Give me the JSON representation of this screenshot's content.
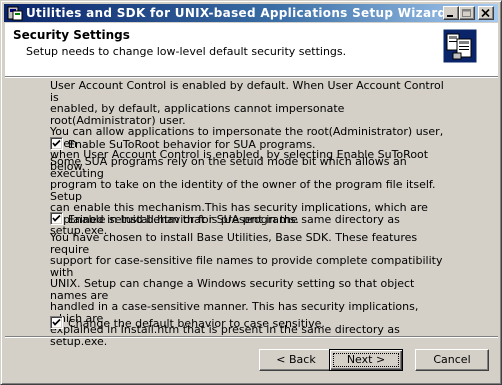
{
  "window": {
    "title": "Utilities and SDK for UNIX-based Applications Setup Wizard"
  },
  "header": {
    "title": "Security Settings",
    "subtitle": "Setup needs to change low-level default security settings."
  },
  "content": {
    "paragraphs": [
      [
        "User Account Control is enabled by default. When User Account Control is",
        "enabled, by default, applications cannot impersonate root(Administrator) user.",
        "You can allow applications to impersonate the root(Administrator) user, even",
        "when User Account Control is enabled, by selecting Enable SuToRoot below."
      ],
      [
        "Some SUA programs rely on the setuid mode bit which allows an executing",
        "program to take on the identity of the owner of the program file itself. Setup",
        "can enable this mechanism.This has security implications, which are",
        "explained in Install.htm that is present in the same directory as setup.exe."
      ],
      [
        "You have chosen to install Base Utilities, Base SDK. These features require",
        "support for case-sensitive file names to provide complete compatibility with",
        "UNIX. Setup can change a Windows security setting so that object names are",
        "handled in a case-sensitive manner. This has security implications, which are",
        "explained in Install.htm that is present in the same directory as setup.exe."
      ]
    ],
    "checkboxes": [
      {
        "label": "Enable SuToRoot behavior for SUA programs.",
        "checked": true
      },
      {
        "label": "Enable setuid behavior for SUA programs.",
        "checked": true
      },
      {
        "label": "Change the default behavior to case sensitive.",
        "checked": true
      }
    ]
  },
  "buttons": {
    "back": "< Back",
    "next": "Next >",
    "cancel": "Cancel"
  }
}
